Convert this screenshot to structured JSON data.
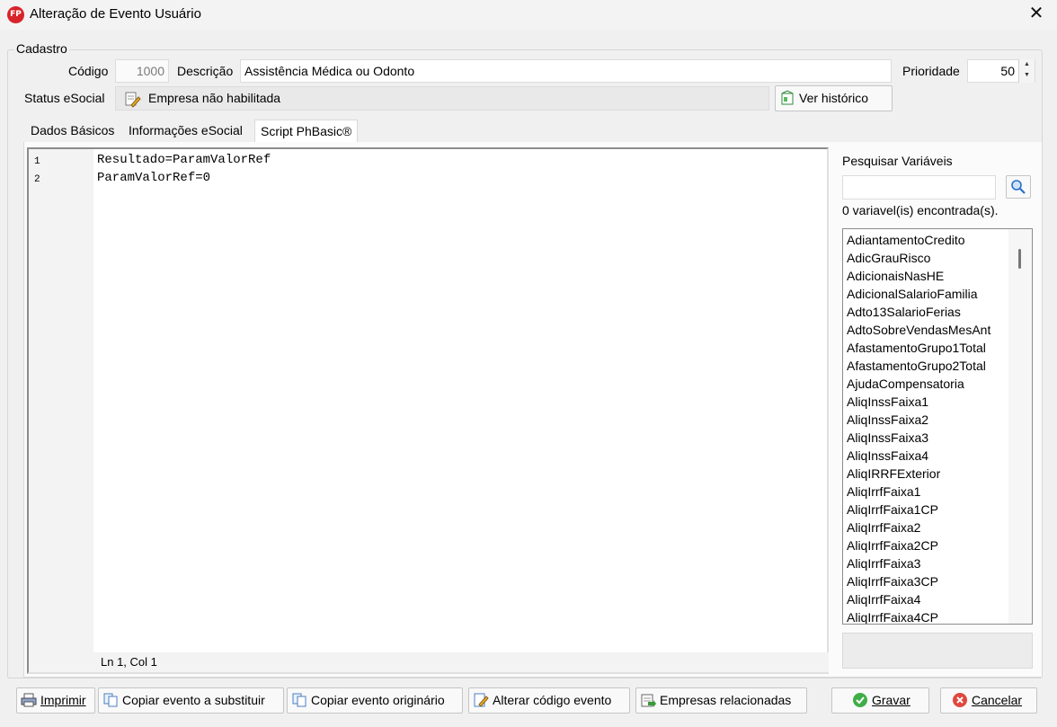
{
  "window": {
    "title": "Alteração de Evento Usuário",
    "icon_text": "FP"
  },
  "cadastro": {
    "group_title": "Cadastro",
    "codigo_label": "Código",
    "codigo_value": "1000",
    "descricao_label": "Descrição",
    "descricao_value": "Assistência Médica ou Odonto",
    "prioridade_label": "Prioridade",
    "prioridade_value": "50",
    "status_label": "Status eSocial",
    "status_value": "Empresa não habilitada",
    "ver_historico": "Ver histórico"
  },
  "tabs": [
    {
      "label": "Dados Básicos"
    },
    {
      "label": "Informações eSocial"
    },
    {
      "label": "Script PhBasic®"
    }
  ],
  "editor": {
    "lines": [
      {
        "num": "1",
        "text": "Resultado=ParamValorRef"
      },
      {
        "num": "2",
        "text": "ParamValorRef=0"
      }
    ],
    "status": "Ln 1, Col 1"
  },
  "variables": {
    "search_label": "Pesquisar Variáveis",
    "search_value": "",
    "found_text": "0 variavel(is) encontrada(s).",
    "items": [
      "AdiantamentoCredito",
      "AdicGrauRisco",
      "AdicionaisNasHE",
      "AdicionalSalarioFamilia",
      "Adto13SalarioFerias",
      "AdtoSobreVendasMesAnt",
      "AfastamentoGrupo1Total",
      "AfastamentoGrupo2Total",
      "AjudaCompensatoria",
      "AliqInssFaixa1",
      "AliqInssFaixa2",
      "AliqInssFaixa3",
      "AliqInssFaixa4",
      "AliqIRRFExterior",
      "AliqIrrfFaixa1",
      "AliqIrrfFaixa1CP",
      "AliqIrrfFaixa2",
      "AliqIrrfFaixa2CP",
      "AliqIrrfFaixa3",
      "AliqIrrfFaixa3CP",
      "AliqIrrfFaixa4",
      "AliqIrrfFaixa4CP"
    ]
  },
  "footer": {
    "imprimir": "Imprimir",
    "copiar_substituir": "Copiar evento a substituir",
    "copiar_originario": "Copiar evento originário",
    "alterar_codigo": "Alterar código evento",
    "empresas": "Empresas relacionadas",
    "gravar": "Gravar",
    "cancelar": "Cancelar"
  },
  "colors": {
    "brand": "#d8232a",
    "window_bg": "#f0f0f0",
    "search_icon": "#2a6fc9"
  }
}
